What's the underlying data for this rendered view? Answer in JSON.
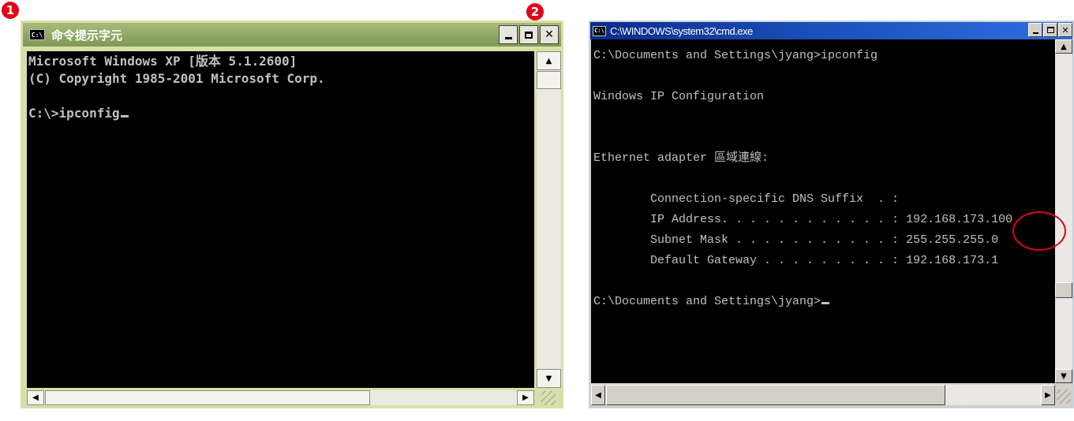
{
  "markers": {
    "first": "1",
    "second": "2"
  },
  "window1": {
    "icon_text": "C:\\",
    "title": "命令提示字元",
    "lines": [
      "Microsoft Windows XP [版本 5.1.2600]",
      "(C) Copyright 1985-2001 Microsoft Corp.",
      "",
      "C:\\>ipconfig"
    ]
  },
  "window2": {
    "icon_text": "C:\\",
    "title": "C:\\WINDOWS\\system32\\cmd.exe",
    "lines": [
      "C:\\Documents and Settings\\jyang>ipconfig",
      "",
      "Windows IP Configuration",
      "",
      "",
      "Ethernet adapter 區域連線:",
      "",
      "        Connection-specific DNS Suffix  . :",
      "        IP Address. . . . . . . . . . . . : 192.168.173.100",
      "        Subnet Mask . . . . . . . . . . . : 255.255.255.0",
      "        Default Gateway . . . . . . . . . : 192.168.173.1",
      "",
      "C:\\Documents and Settings\\jyang>"
    ]
  },
  "icons": {
    "minimize": "minimize-icon",
    "maximize": "maximize-icon",
    "close": "close-icon",
    "scroll_up": "arrow-up-icon",
    "scroll_down": "arrow-down-icon",
    "scroll_left": "arrow-left-icon",
    "scroll_right": "arrow-right-icon",
    "resize": "resize-grip-icon"
  },
  "colors": {
    "xp_titlebar": "#8fa765",
    "classic_titlebar": "#0a2a8a",
    "console_bg": "#000000",
    "console_text": "#c0c0c0",
    "marker": "#e0001a"
  }
}
